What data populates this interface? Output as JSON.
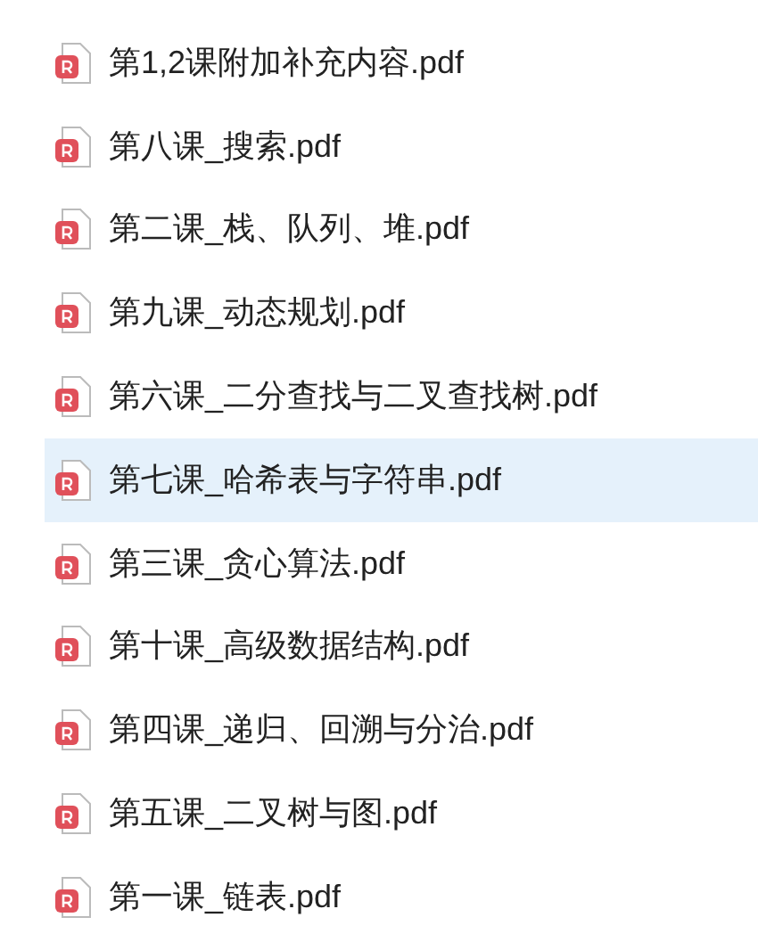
{
  "files": [
    {
      "name": "第1,2课附加补充内容.pdf",
      "selected": false
    },
    {
      "name": "第八课_搜索.pdf",
      "selected": false
    },
    {
      "name": "第二课_栈、队列、堆.pdf",
      "selected": false
    },
    {
      "name": "第九课_动态规划.pdf",
      "selected": false
    },
    {
      "name": "第六课_二分查找与二叉查找树.pdf",
      "selected": false
    },
    {
      "name": "第七课_哈希表与字符串.pdf",
      "selected": true
    },
    {
      "name": "第三课_贪心算法.pdf",
      "selected": false
    },
    {
      "name": "第十课_高级数据结构.pdf",
      "selected": false
    },
    {
      "name": "第四课_递归、回溯与分治.pdf",
      "selected": false
    },
    {
      "name": "第五课_二叉树与图.pdf",
      "selected": false
    },
    {
      "name": "第一课_链表.pdf",
      "selected": false
    }
  ]
}
